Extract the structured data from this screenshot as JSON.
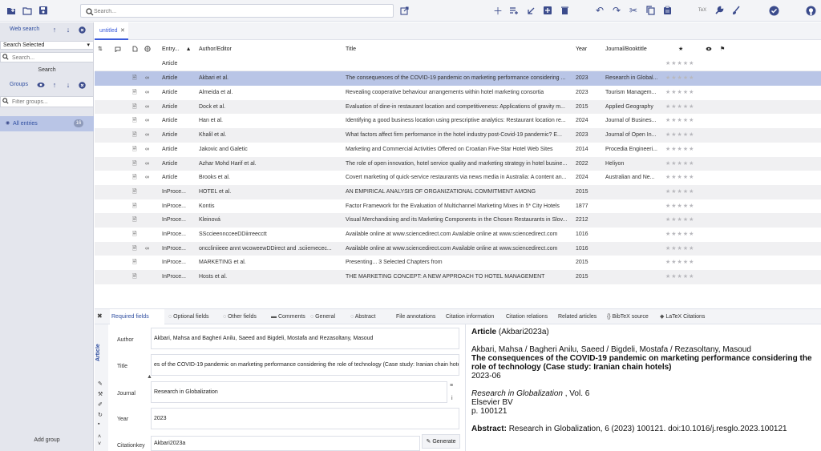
{
  "toolbar": {
    "left_icons": [
      "new-library-icon",
      "open-folder-icon",
      "save-icon"
    ],
    "search_placeholder": "Search...",
    "right_icons": [
      "plus-icon",
      "add-list-icon",
      "import-arrow-icon",
      "add-box-icon",
      "trash-icon",
      "undo-icon",
      "redo-icon",
      "scissors-icon",
      "copy-icon",
      "paste-icon",
      "tex-icon",
      "wrench-icon",
      "brush-icon",
      "check-circle-icon",
      "github-icon"
    ],
    "tex_label": "TeX"
  },
  "sidebar": {
    "web_search_label": "Web search",
    "search_selected": "Search Selected",
    "search_placeholder": "Search...",
    "search_button": "Search",
    "groups_label": "Groups",
    "filter_placeholder": "Filter groups...",
    "all_entries_label": "All entries",
    "all_entries_count": "16",
    "add_group_label": "Add group"
  },
  "tabs": [
    {
      "label": "untitled",
      "close": "✕"
    }
  ],
  "table": {
    "columns": {
      "entrytype": "Entry...",
      "author": "Author/Editor",
      "title": "Title",
      "year": "Year",
      "journal": "Journal/Booktitle"
    },
    "filter_row_type": "Article",
    "rows": [
      {
        "type": "Article",
        "author": "Akbari et al.",
        "title": "The consequences of the COVID-19 pandemic on marketing performance considering ...",
        "year": "2023",
        "journal": "Research in Global...",
        "link": true,
        "file": true
      },
      {
        "type": "Article",
        "author": "Almeida et al.",
        "title": "Revealing cooperative behaviour arrangements within hotel marketing consortia",
        "year": "2023",
        "journal": "Tourism Managem...",
        "link": true,
        "file": true
      },
      {
        "type": "Article",
        "author": "Dock et al.",
        "title": "Evaluation of dine-in restaurant location and competitiveness: Applications of gravity m...",
        "year": "2015",
        "journal": "Applied Geography",
        "link": true,
        "file": true
      },
      {
        "type": "Article",
        "author": "Han et al.",
        "title": "Identifying a good business location using prescriptive analytics: Restaurant location re...",
        "year": "2024",
        "journal": "Journal of Busines...",
        "link": true,
        "file": true
      },
      {
        "type": "Article",
        "author": "Khalil et al.",
        "title": "What factors affect firm performance in the hotel industry post-Covid-19 pandemic? E...",
        "year": "2023",
        "journal": "Journal of Open In...",
        "link": true,
        "file": true
      },
      {
        "type": "Article",
        "author": "Jakovic and Galetic",
        "title": "Marketing and Commercial Activities Offered on Croatian Five-Star Hotel Web Sites",
        "year": "2014",
        "journal": "Procedia Engineeri...",
        "link": true,
        "file": true
      },
      {
        "type": "Article",
        "author": "Azhar Mohd Harif et al.",
        "title": "The role of open innovation, hotel service quality and marketing strategy in hotel busine...",
        "year": "2022",
        "journal": "Heliyon",
        "link": true,
        "file": true
      },
      {
        "type": "Article",
        "author": "Brooks et al.",
        "title": "Covert marketing of quick-service restaurants via news media in Australia: A content an...",
        "year": "2024",
        "journal": "Australian and Ne...",
        "link": true,
        "file": true
      },
      {
        "type": "InProce...",
        "author": "HOTEL et al.",
        "title": "AN EMPIRICAL ANALYSIS OF ORGANIZATIONAL COMMITMENT AMONG",
        "year": "2015",
        "journal": "",
        "link": false,
        "file": true
      },
      {
        "type": "InProce...",
        "author": "Kontis",
        "title": "Factor Framework for the Evaluation of Multichannel Marketing Mixes in 5* City Hotels",
        "year": "1877",
        "journal": "",
        "link": false,
        "file": true
      },
      {
        "type": "InProce...",
        "author": "Kleinová",
        "title": "Visual Merchandising and its Marketing Components in the Chosen Restaurants in Slov...",
        "year": "2212",
        "journal": "",
        "link": false,
        "file": true
      },
      {
        "type": "InProce...",
        "author": "SSccieenncceeDDiirreecctt",
        "title": "Available online at www.sciencedirect.com Available online at www.sciencedirect.com",
        "year": "1016",
        "journal": "",
        "link": false,
        "file": true
      },
      {
        "type": "InProce...",
        "author": "onccliniieee annt wcoweewDDirect and .sciiemecec...",
        "title": "Available online at www.sciencedirect.com Available online at www.sciencedirect.com",
        "year": "1016",
        "journal": "",
        "link": true,
        "file": true
      },
      {
        "type": "InProce...",
        "author": "MARKETING et al.",
        "title": "Presenting... 3 Selected Chapters from",
        "year": "2015",
        "journal": "",
        "link": false,
        "file": true
      },
      {
        "type": "InProce...",
        "author": "Hosts et al.",
        "title": "THE MARKETING CONCEPT: A NEW APPROACH TO HOTEL MANAGEMENT",
        "year": "2015",
        "journal": "",
        "link": false,
        "file": true
      }
    ],
    "selected_index": 0,
    "rating_stars": "★★★★★"
  },
  "editor": {
    "tabs": [
      "Required fields",
      "Optional fields",
      "Other fields",
      "Comments",
      "General",
      "Abstract",
      "File annotations",
      "Citation information",
      "Citation relations",
      "Related articles",
      "BibTeX source",
      "LaTeX Citations"
    ],
    "entry_type_vertical": "Article",
    "fields": [
      {
        "label": "Author",
        "value": "Akbari, Mahsa and Bagheri Anilu, Saeed and Bigdeli, Mostafa and Rezasoltany, Masoud"
      },
      {
        "label": "Title",
        "value": "es of the COVID-19 pandemic on marketing performance considering the role of technology (Case study: Iranian chain hotels"
      },
      {
        "label": "Journal",
        "value": "Research in Globalization"
      },
      {
        "label": "Year",
        "value": "2023"
      },
      {
        "label": "Citationkey",
        "value": "Akbari2023a"
      }
    ],
    "generate_label": "Generate"
  },
  "preview": {
    "type": "Article",
    "key": "(Akbari2023a)",
    "authors": "Akbari, Mahsa / Bagheri Anilu, Saeed / Bigdeli, Mostafa / Rezasoltany, Masoud",
    "title": "The consequences of the COVID-19 pandemic on marketing performance considering the role of technology (Case study: Iranian chain hotels)",
    "date": "2023-06",
    "journal": "Research in Globalization",
    "volume": ", Vol. 6",
    "publisher": "Elsevier BV",
    "pages": "p. 100121",
    "abstract_label": "Abstract:",
    "abstract": "Research in Globalization, 6 (2023) 100121. doi:10.1016/j.resglo.2023.100121"
  },
  "colors": {
    "accent": "#3b4b8c",
    "selection": "#b9c5e6",
    "sidebar": "#e4e6ed"
  }
}
